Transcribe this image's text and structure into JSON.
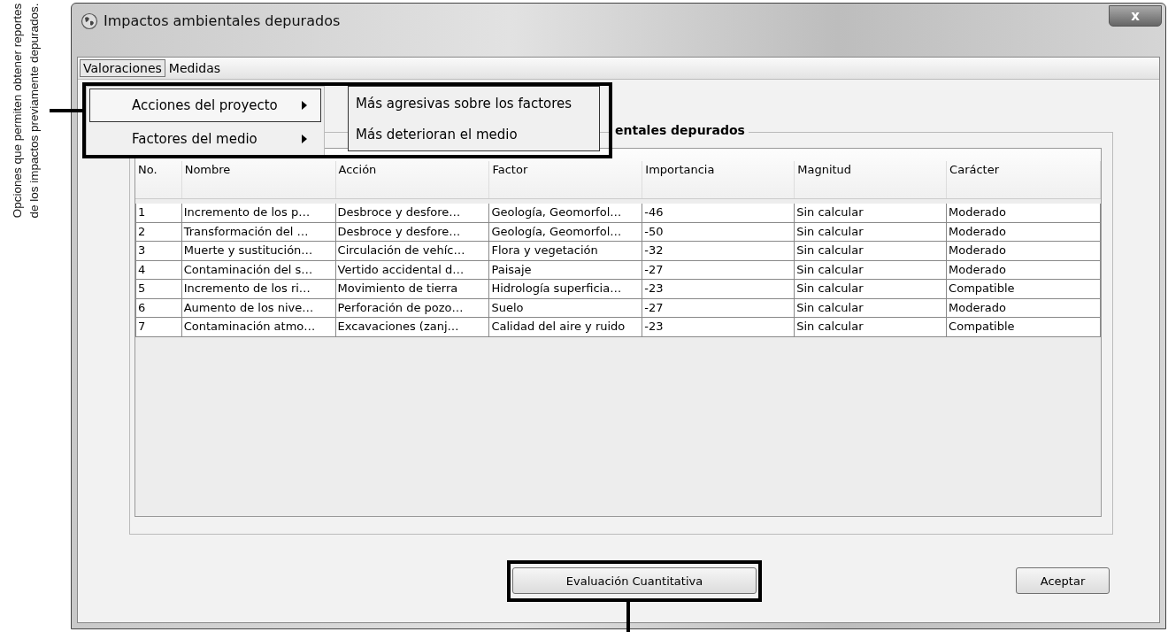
{
  "annotation": {
    "lines": [
      "Opciones que permiten obtener reportes",
      "de los impactos previamente depurados."
    ]
  },
  "window": {
    "title": "Impactos ambientales depurados",
    "close": "x"
  },
  "menu_bar": [
    {
      "label": "Valoraciones",
      "selected": true
    },
    {
      "label": "Medidas",
      "selected": false
    }
  ],
  "menu": [
    {
      "label": "Acciones del proyecto",
      "selected": true
    },
    {
      "label": "Factores del medio",
      "selected": false
    }
  ],
  "submenu": [
    "Más agresivas sobre los factores",
    "Más deterioran el medio"
  ],
  "group": {
    "title": "entales depurados"
  },
  "table": {
    "columns": [
      "No.",
      "Nombre",
      "Acción",
      "Factor",
      "Importancia",
      "Magnitud",
      "Carácter"
    ],
    "rows": [
      [
        "1",
        "Incremento de los p…",
        "Desbroce y desfore…",
        "Geología, Geomorfol…",
        "-46",
        "Sin calcular",
        "Moderado"
      ],
      [
        "2",
        "Transformación del …",
        "Desbroce y desfore…",
        "Geología, Geomorfol…",
        "-50",
        "Sin calcular",
        "Moderado"
      ],
      [
        "3",
        "Muerte y sustitución…",
        "Circulación de vehíc…",
        "Flora y vegetación",
        "-32",
        "Sin calcular",
        "Moderado"
      ],
      [
        "4",
        "Contaminación del s…",
        "Vertido accidental d…",
        "Paisaje",
        "-27",
        "Sin calcular",
        "Moderado"
      ],
      [
        "5",
        "Incremento de los ri…",
        "Movimiento de tierra",
        "Hidrología superficia…",
        "-23",
        "Sin calcular",
        "Compatible"
      ],
      [
        "6",
        "Aumento de los nive…",
        "Perforación de pozo…",
        "Suelo",
        "-27",
        "Sin calcular",
        "Moderado"
      ],
      [
        "7",
        "Contaminación atmo…",
        "Excavaciones (zanj…",
        "Calidad del aire y ruido",
        "-23",
        "Sin calcular",
        "Compatible"
      ]
    ]
  },
  "buttons": {
    "evaluate": "Evaluación Cuantitativa",
    "accept": "Aceptar"
  }
}
